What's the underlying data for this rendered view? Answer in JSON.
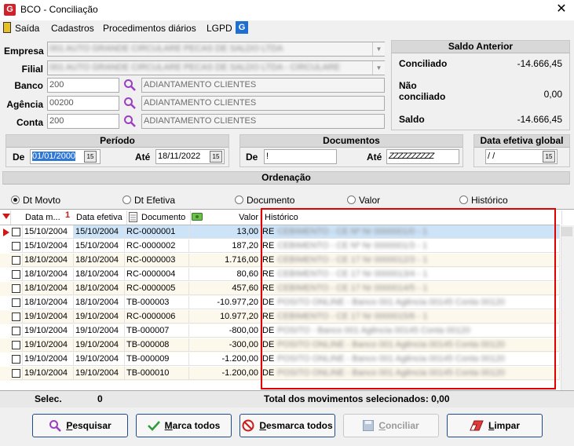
{
  "window": {
    "title": "BCO - Conciliação",
    "close": "✕",
    "app_icon": "G"
  },
  "menu": {
    "items": [
      "Saída",
      "Cadastros",
      "Procedimentos diários",
      "LGPD"
    ]
  },
  "form": {
    "empresa": {
      "label": "Empresa",
      "value": "001 AUTO GRANDE CIRCULARE PECAS DE SALDO LTDA"
    },
    "filial": {
      "label": "Filial",
      "value": "001 AUTO GRANDE CIRCULARE PECAS DE SALDO LTDA - CIRCULARE"
    },
    "banco": {
      "label": "Banco",
      "code": "200",
      "desc": "ADIANTAMENTO CLIENTES"
    },
    "agencia": {
      "label": "Agência",
      "code": "00200",
      "desc": "ADIANTAMENTO CLIENTES"
    },
    "conta": {
      "label": "Conta",
      "code": "200",
      "desc": "ADIANTAMENTO CLIENTES"
    }
  },
  "saldo": {
    "title": "Saldo Anterior",
    "conciliado_label": "Conciliado",
    "conciliado_value": "-14.666,45",
    "nao_conciliado_label1": "Não",
    "nao_conciliado_label2": "conciliado",
    "nao_conciliado_value": "0,00",
    "saldo_label": "Saldo",
    "saldo_value": "-14.666,45"
  },
  "periodo": {
    "title": "Período",
    "de_label": "De",
    "de_value": "01/01/2000",
    "ate_label": "Até",
    "ate_value": "18/11/2022",
    "cal": "15"
  },
  "documentos": {
    "title": "Documentos",
    "de_label": "De",
    "de_value": "!",
    "ate_label": "Até",
    "ate_value": "ZZZZZZZZZZ"
  },
  "data_efetiva": {
    "title": "Data efetiva global",
    "value": " / /",
    "cal": "15"
  },
  "ordenacao": {
    "title": "Ordenação",
    "options": [
      "Dt Movto",
      "Dt Efetiva",
      "Documento",
      "Valor",
      "Histórico"
    ],
    "selected": "Dt Movto"
  },
  "grid": {
    "headers": {
      "data_mov": "Data m...",
      "data_efetiva": "Data efetiva",
      "documento": "Documento",
      "valor": "Valor",
      "historico": "Histórico"
    },
    "sort_indicator": "1",
    "rows": [
      {
        "data_mov": "15/10/2004",
        "data_efetiva": "15/10/2004",
        "documento": "RC-0000001",
        "valor": "13,00",
        "hist_prefix": "RE",
        "hist_rest": "CEBIMENTO - CE Nº Nr 0000001/0 - 1"
      },
      {
        "data_mov": "15/10/2004",
        "data_efetiva": "15/10/2004",
        "documento": "RC-0000002",
        "valor": "187,20",
        "hist_prefix": "RE",
        "hist_rest": "CEBIMENTO - CE Nº Nr 0000001/3 - 1"
      },
      {
        "data_mov": "18/10/2004",
        "data_efetiva": "18/10/2004",
        "documento": "RC-0000003",
        "valor": "1.716,00",
        "hist_prefix": "RE",
        "hist_rest": "CEBIMENTO - CE 17 Nr 0000012/3 - 1"
      },
      {
        "data_mov": "18/10/2004",
        "data_efetiva": "18/10/2004",
        "documento": "RC-0000004",
        "valor": "80,60",
        "hist_prefix": "RE",
        "hist_rest": "CEBIMENTO - CE 17 Nr 0000013/4 - 1"
      },
      {
        "data_mov": "18/10/2004",
        "data_efetiva": "18/10/2004",
        "documento": "RC-0000005",
        "valor": "457,60",
        "hist_prefix": "RE",
        "hist_rest": "CEBIMENTO - CE 17 Nr 0000014/5 - 1"
      },
      {
        "data_mov": "18/10/2004",
        "data_efetiva": "18/10/2004",
        "documento": "TB-000003",
        "valor": "-10.977,20",
        "hist_prefix": "DE",
        "hist_rest": "POSITO ONLINE - Banco 001 Agência 00145 Conta 00120"
      },
      {
        "data_mov": "19/10/2004",
        "data_efetiva": "19/10/2004",
        "documento": "RC-0000006",
        "valor": "10.977,20",
        "hist_prefix": "RE",
        "hist_rest": "CEBIMENTO - CE 17 Nr 0000015/6 - 1"
      },
      {
        "data_mov": "19/10/2004",
        "data_efetiva": "19/10/2004",
        "documento": "TB-000007",
        "valor": "-800,00",
        "hist_prefix": "DE",
        "hist_rest": "POSITO - Banco 001 Agência 00145 Conta 00120"
      },
      {
        "data_mov": "19/10/2004",
        "data_efetiva": "19/10/2004",
        "documento": "TB-000008",
        "valor": "-300,00",
        "hist_prefix": "DE",
        "hist_rest": "POSITO ONLINE - Banco 001 Agência 00145 Conta 00120"
      },
      {
        "data_mov": "19/10/2004",
        "data_efetiva": "19/10/2004",
        "documento": "TB-000009",
        "valor": "-1.200,00",
        "hist_prefix": "DE",
        "hist_rest": "POSITO ONLINE - Banco 001 Agência 00145 Conta 00120"
      },
      {
        "data_mov": "19/10/2004",
        "data_efetiva": "19/10/2004",
        "documento": "TB-000010",
        "valor": "-1.200,00",
        "hist_prefix": "DE",
        "hist_rest": "POSITO ONLINE - Banco 001 Agência 00145 Conta 00120"
      }
    ],
    "footer": {
      "selec_label": "Selec.",
      "selec_value": "0",
      "total_label": "Total dos movimentos selecionados: 0,00"
    }
  },
  "buttons": {
    "pesquisar": {
      "u": "P",
      "rest": "esquisar"
    },
    "marca_todos": {
      "u": "M",
      "rest": "arca todos"
    },
    "desmarca_todos": {
      "u": "D",
      "rest": "esmarca todos"
    },
    "conciliar": {
      "u": "C",
      "rest": "onciliar"
    },
    "limpar": {
      "u": "L",
      "rest": "impar"
    }
  },
  "colors": {
    "accent": "#1b4b8a",
    "highlight": "#e00000",
    "selected_row": "#cde3f7"
  }
}
